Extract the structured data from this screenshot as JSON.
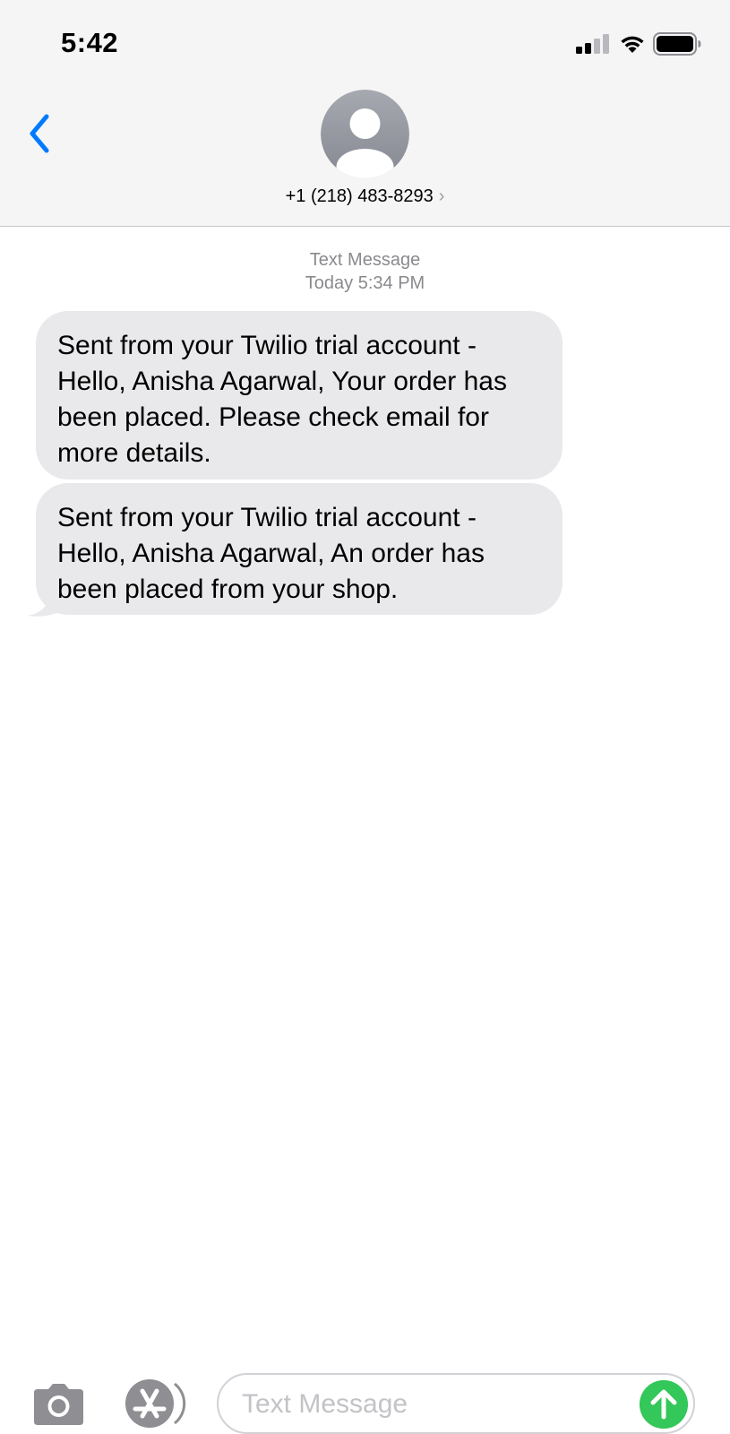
{
  "status_bar": {
    "time": "5:42",
    "icons": [
      "cellular-signal-icon",
      "wifi-icon",
      "battery-icon"
    ]
  },
  "header": {
    "back_icon": "chevron-left-icon",
    "avatar_icon": "person-silhouette-icon",
    "contact": "+1 (218) 483-8293",
    "contact_chevron": "›"
  },
  "thread": {
    "service_label": "Text Message",
    "timestamp": "Today 5:34 PM",
    "messages": [
      {
        "direction": "incoming",
        "text": "Sent from your Twilio trial account - Hello, Anisha Agarwal, Your order has been placed. Please check email for more details."
      },
      {
        "direction": "incoming",
        "text": "Sent from your Twilio trial account - Hello, Anisha Agarwal, An order has been placed from your shop."
      }
    ]
  },
  "composer": {
    "camera_icon": "camera-icon",
    "apps_icon": "app-store-icon",
    "placeholder": "Text Message",
    "value": "",
    "send_icon": "arrow-up-icon"
  },
  "colors": {
    "accent": "#007aff",
    "incoming_bubble": "#e9e9eb",
    "send_button": "#34c759",
    "header_bg": "#f5f5f6",
    "meta_text": "#8a8a8e"
  }
}
